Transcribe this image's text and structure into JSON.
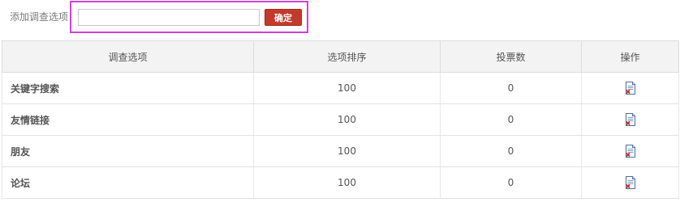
{
  "add_option": {
    "label": "添加调查选项：",
    "input_value": "",
    "input_placeholder": "",
    "confirm_label": "确定"
  },
  "table": {
    "headers": [
      "调查选项",
      "选项排序",
      "投票数",
      "操作"
    ],
    "rows": [
      {
        "name": "关键字搜索",
        "order": "100",
        "votes": "0",
        "action_icon": "delete-document-icon"
      },
      {
        "name": "友情链接",
        "order": "100",
        "votes": "0",
        "action_icon": "delete-document-icon"
      },
      {
        "name": "朋友",
        "order": "100",
        "votes": "0",
        "action_icon": "delete-document-icon"
      },
      {
        "name": "论坛",
        "order": "100",
        "votes": "0",
        "action_icon": "delete-document-icon"
      }
    ]
  },
  "colors": {
    "confirm_button": "#c23a2c",
    "highlight_border": "#d042d8",
    "header_background": "#f3f3f3"
  }
}
